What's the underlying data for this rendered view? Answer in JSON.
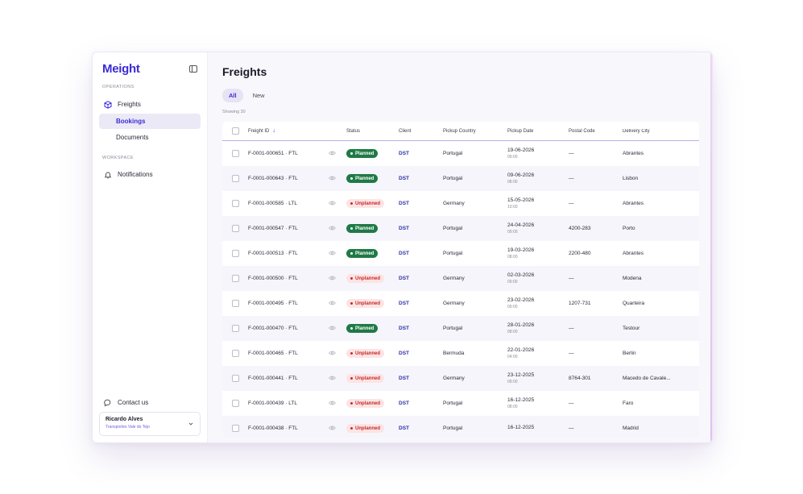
{
  "app": {
    "logo": "Meight"
  },
  "sidebar": {
    "operations_label": "OPERATIONS",
    "workspace_label": "WORKSPACE",
    "items": [
      {
        "label": "Freights",
        "icon": "box-icon"
      },
      {
        "label": "Bookings"
      },
      {
        "label": "Documents"
      },
      {
        "label": "Notifications",
        "icon": "bell-icon"
      }
    ],
    "contact_label": "Contact us",
    "user": {
      "name": "Ricardo Alves",
      "company": "Transportes Vale do Tejo"
    }
  },
  "main": {
    "title": "Freights",
    "tabs": [
      {
        "label": "All"
      },
      {
        "label": "New"
      }
    ],
    "showing": "Showing 30"
  },
  "table": {
    "headers": {
      "freight_id": "Freight ID",
      "status": "Status",
      "client": "Client",
      "pickup_country": "Pickup Country",
      "pickup_date": "Pickup Date",
      "postal_code": "Postal Code",
      "delivery_city": "Delivery City"
    },
    "rows": [
      {
        "id": "F-0001-000651 · FTL",
        "status": "Planned",
        "client": "DST",
        "country": "Portugal",
        "date": "19-06-2026",
        "time": "09:00",
        "postal": "—",
        "city": "Abrantes"
      },
      {
        "id": "F-0001-000643 · FTL",
        "status": "Planned",
        "client": "DST",
        "country": "Portugal",
        "date": "09-06-2026",
        "time": "08:00",
        "postal": "—",
        "city": "Lisbon"
      },
      {
        "id": "F-0001-000585 · LTL",
        "status": "Unplanned",
        "client": "DST",
        "country": "Germany",
        "date": "15-05-2026",
        "time": "10:00",
        "postal": "—",
        "city": "Abrantes"
      },
      {
        "id": "F-0001-000547 · FTL",
        "status": "Planned",
        "client": "DST",
        "country": "Portugal",
        "date": "24-04-2026",
        "time": "09:00",
        "postal": "4200-283",
        "city": "Porto"
      },
      {
        "id": "F-0001-000513 · FTL",
        "status": "Planned",
        "client": "DST",
        "country": "Portugal",
        "date": "19-03-2026",
        "time": "08:00",
        "postal": "2200-480",
        "city": "Abrantes"
      },
      {
        "id": "F-0001-000500 · FTL",
        "status": "Unplanned",
        "client": "DST",
        "country": "Germany",
        "date": "02-03-2026",
        "time": "09:00",
        "postal": "—",
        "city": "Modena"
      },
      {
        "id": "F-0001-000495 · FTL",
        "status": "Unplanned",
        "client": "DST",
        "country": "Germany",
        "date": "23-02-2026",
        "time": "09:00",
        "postal": "1207-731",
        "city": "Quarteira"
      },
      {
        "id": "F-0001-000470 · FTL",
        "status": "Planned",
        "client": "DST",
        "country": "Portugal",
        "date": "28-01-2026",
        "time": "08:00",
        "postal": "—",
        "city": "Testour"
      },
      {
        "id": "F-0001-000465 · FTL",
        "status": "Unplanned",
        "client": "DST",
        "country": "Bermuda",
        "date": "22-01-2026",
        "time": "04:00",
        "postal": "—",
        "city": "Berlin"
      },
      {
        "id": "F-0001-000441 · FTL",
        "status": "Unplanned",
        "client": "DST",
        "country": "Germany",
        "date": "23-12-2025",
        "time": "09:00",
        "postal": "8764-301",
        "city": "Macedo de Cavale..."
      },
      {
        "id": "F-0001-000439 · LTL",
        "status": "Unplanned",
        "client": "DST",
        "country": "Portugal",
        "date": "16-12-2025",
        "time": "08:00",
        "postal": "—",
        "city": "Faro"
      },
      {
        "id": "F-0001-000438 · FTL",
        "status": "Unplanned",
        "client": "DST",
        "country": "Portugal",
        "date": "16-12-2025",
        "time": "",
        "postal": "—",
        "city": "Madrid"
      }
    ]
  },
  "colors": {
    "brand": "#3b2bd6",
    "planned": "#1f7a46",
    "unplanned_bg": "#fde4e4",
    "unplanned_text": "#c42b2b"
  }
}
